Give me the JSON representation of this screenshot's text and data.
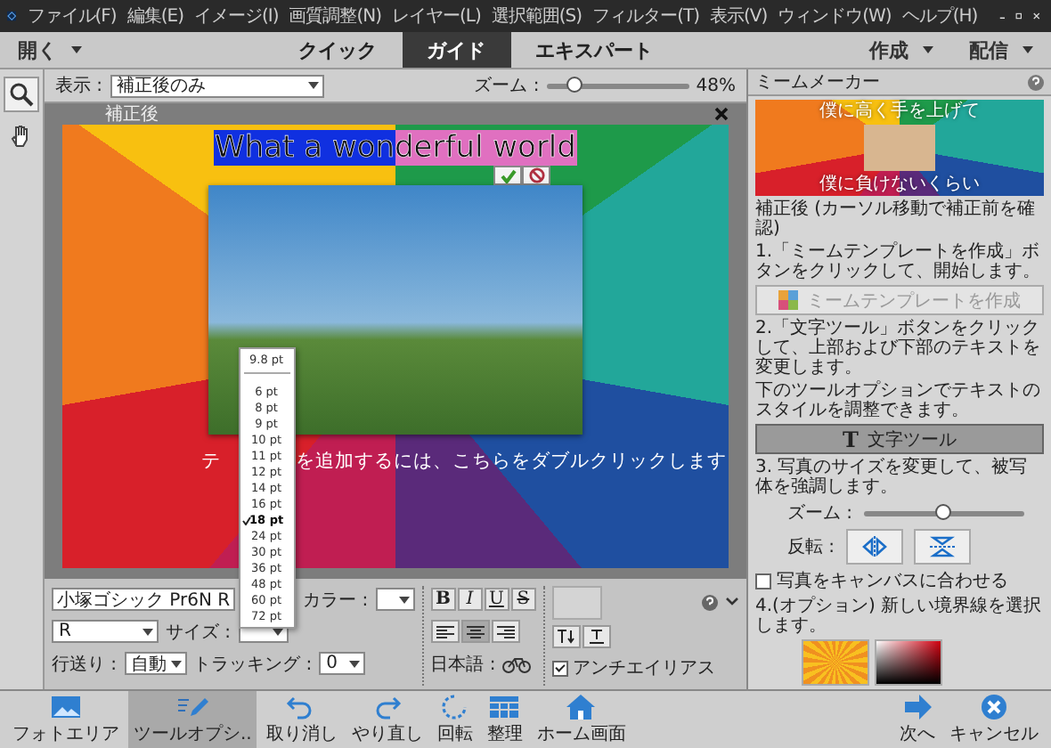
{
  "window": {
    "menu": [
      "ファイル(F)",
      "編集(E)",
      "イメージ(I)",
      "画質調整(N)",
      "レイヤー(L)",
      "選択範囲(S)",
      "フィルター(T)",
      "表示(V)",
      "ウィンドウ(W)",
      "ヘルプ(H)"
    ]
  },
  "mode_bar": {
    "open": "開く",
    "tabs": [
      {
        "label": "クイック",
        "selected": false
      },
      {
        "label": "ガイド",
        "selected": true
      },
      {
        "label": "エキスパート",
        "selected": false
      }
    ],
    "create": "作成",
    "share": "配信"
  },
  "view_bar": {
    "label": "表示 :",
    "view": "補正後のみ",
    "zoom_label": "ズーム :",
    "zoom": {
      "level": 0.2
    },
    "zoom_value": "48%"
  },
  "canvas": {
    "label": "補正後",
    "title": "What a wonderful world",
    "caption_parts": [
      "テ",
      "を追加するには、こちらをダブルクリックします"
    ]
  },
  "size_menu": {
    "current": "9.8 pt",
    "items": [
      {
        "label": "6 pt",
        "selected": false
      },
      {
        "label": "8 pt",
        "selected": false
      },
      {
        "label": "9 pt",
        "selected": false
      },
      {
        "label": "10 pt",
        "selected": false
      },
      {
        "label": "11 pt",
        "selected": false
      },
      {
        "label": "12 pt",
        "selected": false
      },
      {
        "label": "14 pt",
        "selected": false
      },
      {
        "label": "16 pt",
        "selected": false
      },
      {
        "label": "18 pt",
        "selected": true
      },
      {
        "label": "24 pt",
        "selected": false
      },
      {
        "label": "30 pt",
        "selected": false
      },
      {
        "label": "36 pt",
        "selected": false
      },
      {
        "label": "48 pt",
        "selected": false
      },
      {
        "label": "60 pt",
        "selected": false
      },
      {
        "label": "72 pt",
        "selected": false
      }
    ]
  },
  "tool_options": {
    "font": "小塚ゴシック Pr6N R",
    "style": "R",
    "size_label": "サイズ :",
    "color_label": "カラー :",
    "leading_label": "行送り :",
    "leading": "自動",
    "tracking_label": "トラッキング :",
    "tracking": "0",
    "format_buttons": [
      {
        "label": "B",
        "kind": "bold"
      },
      {
        "label": "I",
        "kind": "italic"
      },
      {
        "label": "U",
        "kind": "underline"
      },
      {
        "label": "S",
        "kind": "strike"
      }
    ],
    "align": [
      {
        "selected": false
      },
      {
        "selected": true
      },
      {
        "selected": false
      }
    ],
    "language_label": "日本語 :",
    "antialias": {
      "label": "アンチエイリアス",
      "checked": true
    }
  },
  "panel": {
    "title": "ミームメーカー",
    "preview_top": "僕に高く手を上げて",
    "preview_bottom": "僕に負けないくらい",
    "after_label": "補正後 (カーソル移動で補正前を確認)",
    "step1": "1.「ミームテンプレートを作成」ボタンをクリックして、開始します。",
    "template_button": {
      "label": "ミームテンプレートを作成",
      "disabled": true
    },
    "step2": "2.「文字ツール」ボタンをクリックして、上部および下部のテキストを変更します。",
    "step2_hint": "下のツールオプションでテキストのスタイルを調整できます。",
    "type_button": "文字ツール",
    "type_icon": "T",
    "step3": "3. 写真のサイズを変更して、被写体を強調します。",
    "zoom_label": "ズーム :",
    "zoom": {
      "level": 0.5
    },
    "flip_label": "反転 :",
    "fit": {
      "label": "写真をキャンバスに合わせる",
      "checked": false
    },
    "step4": "4.(オプション) 新しい境界線を選択します。"
  },
  "taskbar": {
    "items": [
      {
        "label": "フォトエリア",
        "selected": false
      },
      {
        "label": "ツールオプシ..",
        "selected": true
      },
      {
        "label": "取り消し",
        "selected": false
      },
      {
        "label": "やり直し",
        "selected": false
      },
      {
        "label": "回転",
        "selected": false
      },
      {
        "label": "整理",
        "selected": false
      },
      {
        "label": "ホーム画面",
        "selected": false
      }
    ],
    "next": "次へ",
    "cancel": "キャンセル"
  }
}
